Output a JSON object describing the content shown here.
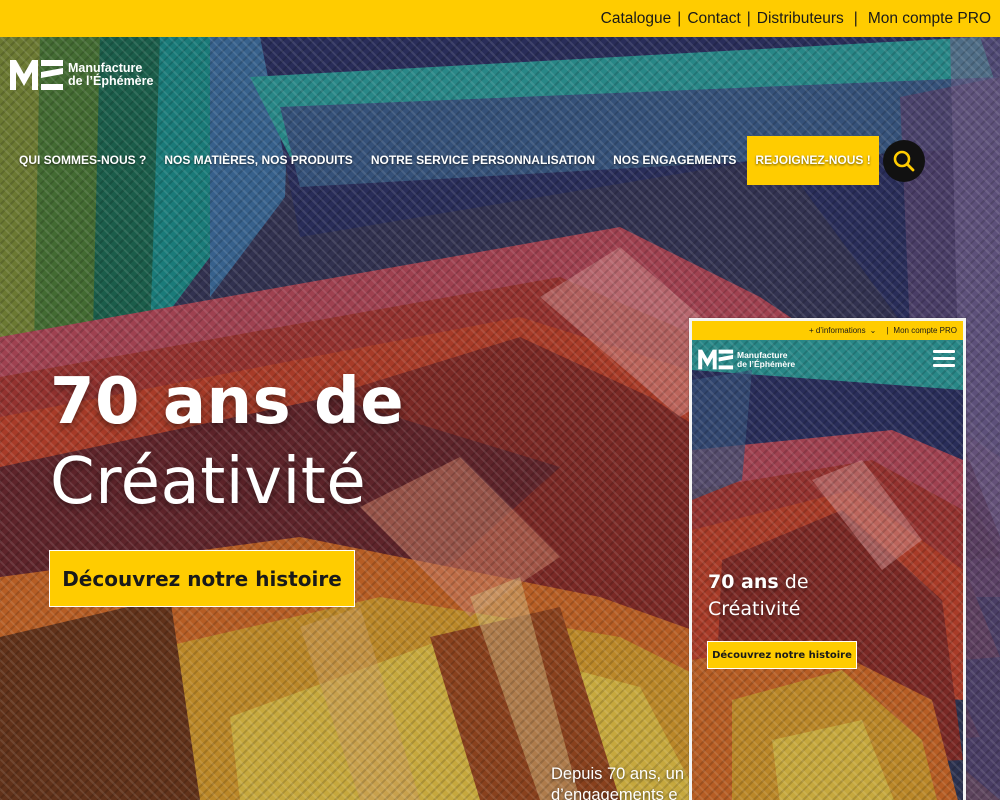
{
  "topbar": {
    "links": [
      "Catalogue",
      "Contact",
      "Distributeurs"
    ],
    "separator": "|",
    "account": "Mon compte PRO",
    "background": "#ffcc00"
  },
  "logo": {
    "icon": "me-monogram-icon",
    "line1": "Manufacture",
    "line2": "de l’Éphémère"
  },
  "nav": {
    "items": [
      "QUI SOMMES-NOUS ?",
      "NOS MATIÈRES, NOS PRODUITS",
      "NOTRE SERVICE PERSONNALISATION",
      "NOS ENGAGEMENTS"
    ],
    "cta": "REJOIGNEZ-NOUS !",
    "search_icon": "search-icon"
  },
  "hero": {
    "title_line1": "70 ans de",
    "title_line2": "Créativité",
    "cta": "Découvrez notre histoire",
    "intro_line1": "Depuis 70 ans, un",
    "intro_line2": "d’engagements e"
  },
  "mobile": {
    "topbar_info": "+ d’informations",
    "topbar_separator": "|",
    "topbar_account": "Mon compte PRO",
    "logo_line1": "Manufacture",
    "logo_line2": "de l’Éphémère",
    "menu_icon": "hamburger-menu-icon",
    "title_bold": "70 ans",
    "title_rest": " de",
    "title_line2": "Créativité",
    "cta": "Découvrez notre histoire"
  },
  "colors": {
    "accent": "#ffcc00",
    "dark": "#111111",
    "text_light": "#ffffff"
  }
}
